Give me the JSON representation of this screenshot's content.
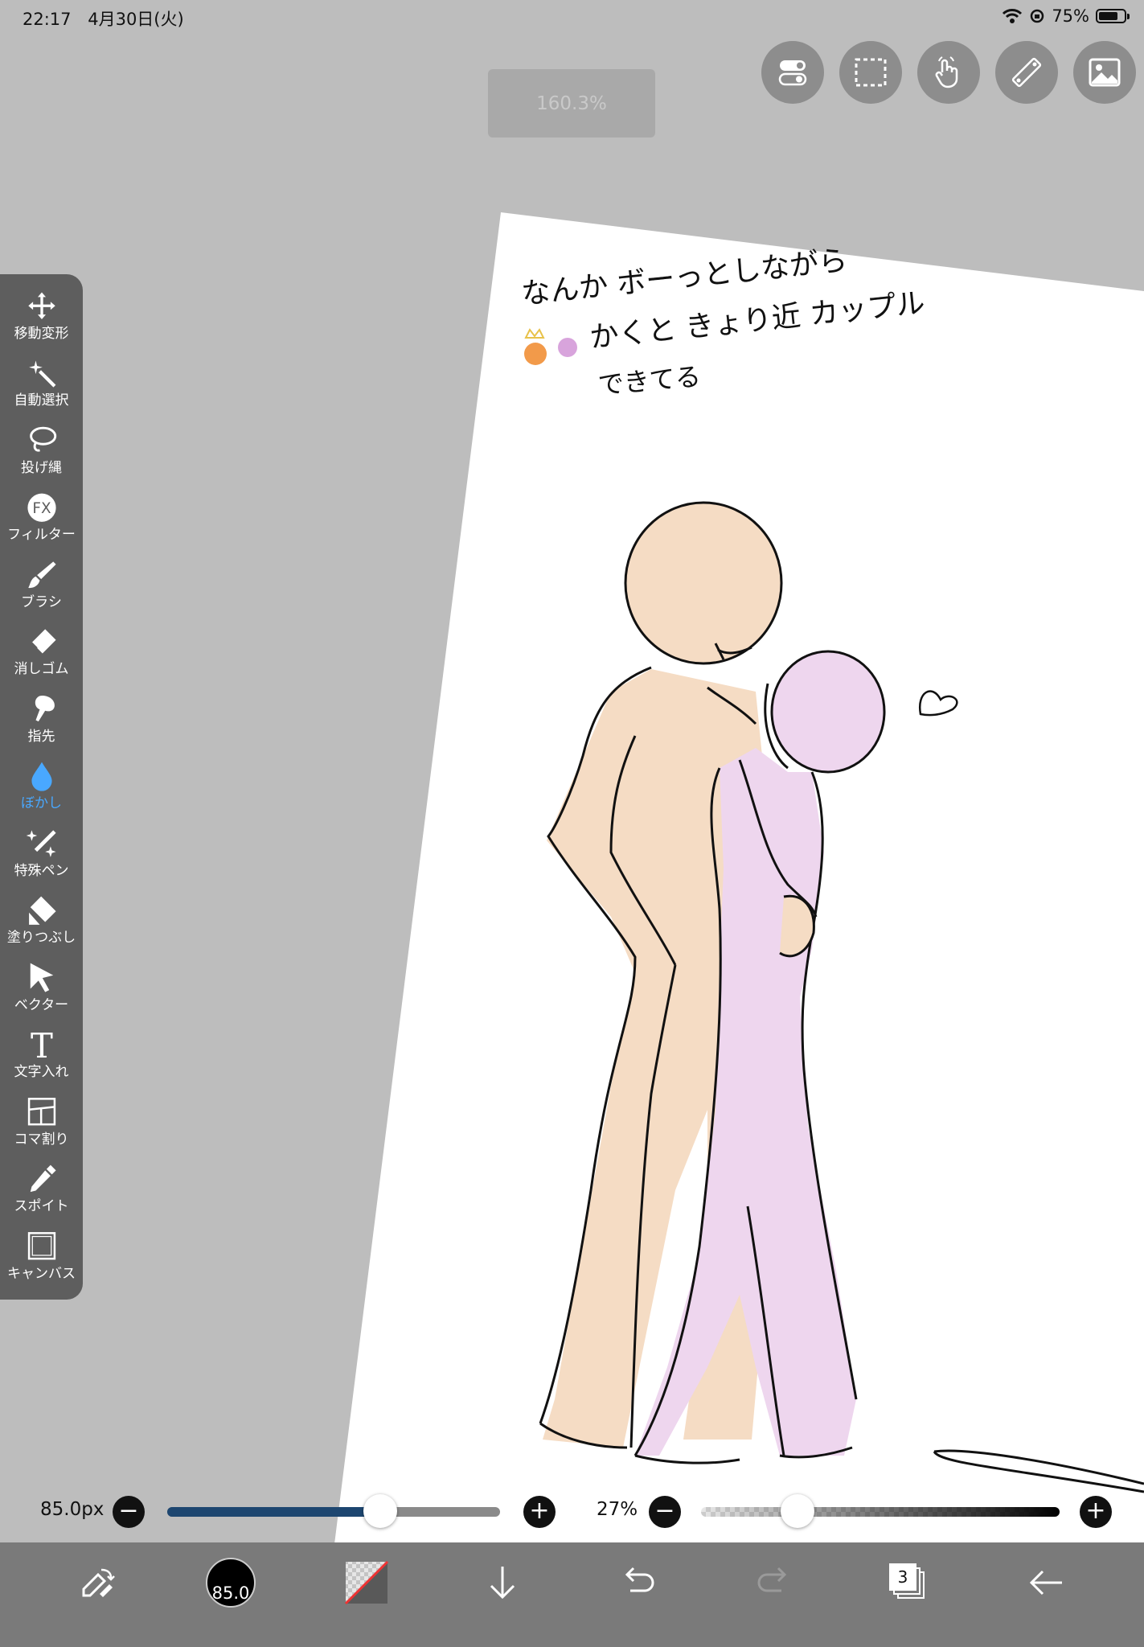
{
  "status_bar": {
    "time": "22:17",
    "date": "4月30日(火)",
    "battery_percent": "75%",
    "battery_level": 0.75
  },
  "zoom_badge": "160.3%",
  "top_tools": [
    {
      "name": "toggle-icon"
    },
    {
      "name": "selection-icon"
    },
    {
      "name": "touch-gesture-icon"
    },
    {
      "name": "ruler-icon"
    },
    {
      "name": "material-image-icon"
    }
  ],
  "sketch_text": {
    "line1": "なんか ボーっとしながら",
    "line2": "かくと きょり近 カップル",
    "line3": "できてる"
  },
  "tools": [
    {
      "name": "move-transform",
      "label": "移動変形",
      "icon": "move-arrows-icon",
      "active": false
    },
    {
      "name": "auto-select",
      "label": "自動選択",
      "icon": "magic-wand-icon",
      "active": false
    },
    {
      "name": "lasso",
      "label": "投げ縄",
      "icon": "lasso-icon",
      "active": false
    },
    {
      "name": "filter",
      "label": "フィルター",
      "icon": "fx-icon",
      "active": false
    },
    {
      "name": "brush",
      "label": "ブラシ",
      "icon": "brush-icon",
      "active": false
    },
    {
      "name": "eraser",
      "label": "消しゴム",
      "icon": "eraser-icon",
      "active": false
    },
    {
      "name": "finger",
      "label": "指先",
      "icon": "finger-icon",
      "active": false
    },
    {
      "name": "blur",
      "label": "ぼかし",
      "icon": "droplet-icon",
      "active": true
    },
    {
      "name": "special-pen",
      "label": "特殊ペン",
      "icon": "sparkle-pen-icon",
      "active": false
    },
    {
      "name": "fill",
      "label": "塗りつぶし",
      "icon": "bucket-icon",
      "active": false
    },
    {
      "name": "vector",
      "label": "ベクター",
      "icon": "cursor-arrow-icon",
      "active": false
    },
    {
      "name": "text",
      "label": "文字入れ",
      "icon": "text-t-icon",
      "active": false
    },
    {
      "name": "frame-divider",
      "label": "コマ割り",
      "icon": "panels-icon",
      "active": false
    },
    {
      "name": "eyedropper",
      "label": "スポイト",
      "icon": "eyedropper-icon",
      "active": false
    },
    {
      "name": "canvas",
      "label": "キャンバス",
      "icon": "canvas-square-icon",
      "active": false
    }
  ],
  "brush_size": {
    "label": "85.0px",
    "value": 85.0,
    "fraction": 0.64
  },
  "opacity": {
    "label": "27%",
    "value": 27,
    "fraction": 0.27
  },
  "bottom_bar": {
    "brush_preview_label": "85.0",
    "layer_count": "3"
  },
  "colors": {
    "accent_blue": "#49a8ff",
    "slider_dark_blue": "#1d4670",
    "skin_fill": "#f5dcc4",
    "purple_fill": "#eed6ee"
  }
}
